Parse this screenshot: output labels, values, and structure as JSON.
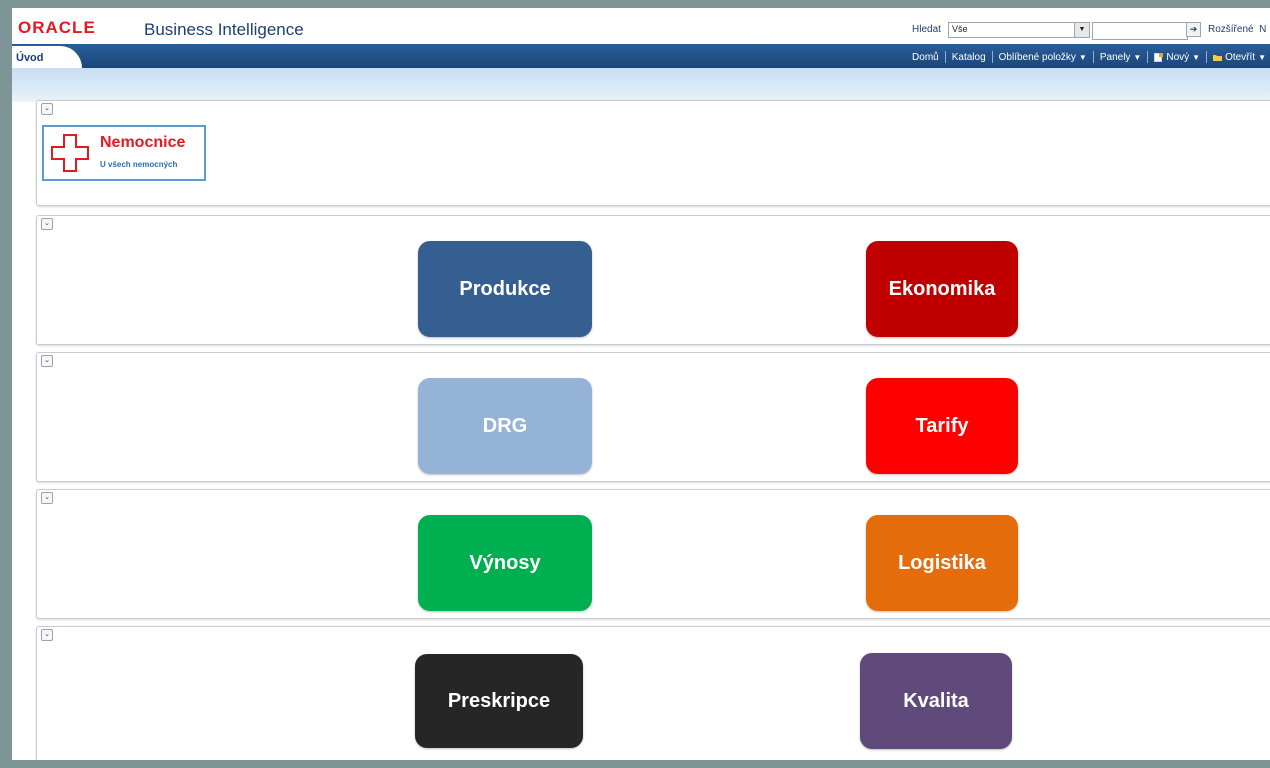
{
  "header": {
    "brand": "ORACLE",
    "product": "Business Intelligence",
    "search_label": "Hledat",
    "search_scope": "Vše",
    "search_value": "",
    "go_icon": "arrow-right-icon",
    "advanced_label": "Rozšířené",
    "help_truncated": "N"
  },
  "nav": {
    "active_tab": "Úvod",
    "menu": [
      {
        "label": "Domů",
        "dropdown": false
      },
      {
        "label": "Katalog",
        "dropdown": false
      },
      {
        "label": "Oblíbené položky",
        "dropdown": true
      },
      {
        "label": "Panely",
        "dropdown": true
      },
      {
        "label": "Nový",
        "dropdown": true,
        "icon": "new-document-icon"
      },
      {
        "label": "Otevřít",
        "dropdown": true,
        "icon": "folder-icon"
      }
    ]
  },
  "logo": {
    "name": "Nemocnice",
    "tagline": "U všech nemocných",
    "icon": "red-cross-icon",
    "color": "#e11b22"
  },
  "tiles": [
    {
      "label": "Produkce",
      "color": "#365f91"
    },
    {
      "label": "Ekonomika",
      "color": "#c00000"
    },
    {
      "label": "DRG",
      "color": "#95b3d7"
    },
    {
      "label": "Tarify",
      "color": "#ff0000"
    },
    {
      "label": "Výnosy",
      "color": "#00b050"
    },
    {
      "label": "Logistika",
      "color": "#e46c0a"
    },
    {
      "label": "Preskripce",
      "color": "#262626"
    },
    {
      "label": "Kvalita",
      "color": "#604a7b"
    }
  ]
}
